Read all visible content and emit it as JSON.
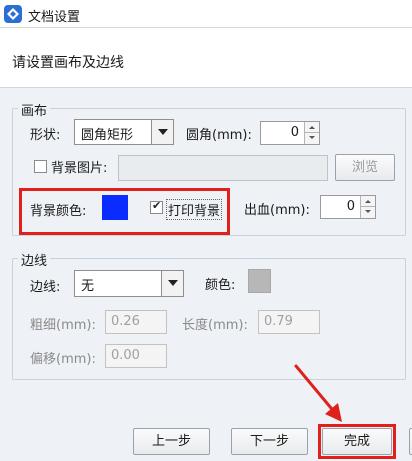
{
  "window": {
    "title": "文档设置",
    "icon": "app-icon"
  },
  "header": {
    "instruction": "请设置画布及边线"
  },
  "canvas": {
    "legend": "画布",
    "shape": {
      "label": "形状:",
      "value": "圆角矩形"
    },
    "corner": {
      "label": "圆角(mm):",
      "value": "0"
    },
    "bg_image": {
      "label": "背景图片:",
      "checked": false,
      "path": "",
      "browse_label": "浏览"
    },
    "bg_color": {
      "label": "背景颜色:",
      "color": "#0a2cff"
    },
    "print_bg": {
      "label": "打印背景",
      "checked": true
    },
    "bleed": {
      "label": "出血(mm):",
      "value": "0"
    }
  },
  "border": {
    "legend": "边线",
    "line": {
      "label": "边线:",
      "value": "无"
    },
    "color": {
      "label": "颜色:",
      "color": "#b7b7b7"
    },
    "thickness": {
      "label": "粗细(mm):",
      "value": "0.26"
    },
    "length": {
      "label": "长度(mm):",
      "value": "0.79"
    },
    "offset": {
      "label": "偏移(mm):",
      "value": "0.00"
    }
  },
  "footer": {
    "prev_label": "上一步",
    "next_label": "下一步",
    "finish_label": "完成"
  },
  "colors": {
    "highlight": "#e0201b",
    "accent": "#2b6fd6"
  }
}
